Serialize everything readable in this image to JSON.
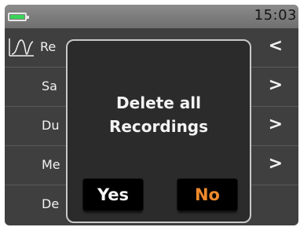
{
  "status_bar": {
    "battery_icon": "battery-icon",
    "battery_color": "#38d45a",
    "time": "15:03"
  },
  "menu": {
    "header": {
      "icon": "waveform-icon",
      "label": "Re",
      "chevron": "<"
    },
    "items": [
      {
        "label": "Sa",
        "chevron": ">"
      },
      {
        "label": "Du",
        "chevron": ">"
      },
      {
        "label": "Me",
        "chevron": ">"
      },
      {
        "label": "De",
        "chevron": ""
      }
    ]
  },
  "dialog": {
    "line1": "Delete all",
    "line2": "Recordings",
    "yes_label": "Yes",
    "no_label": "No",
    "no_color": "#f08a2c"
  }
}
